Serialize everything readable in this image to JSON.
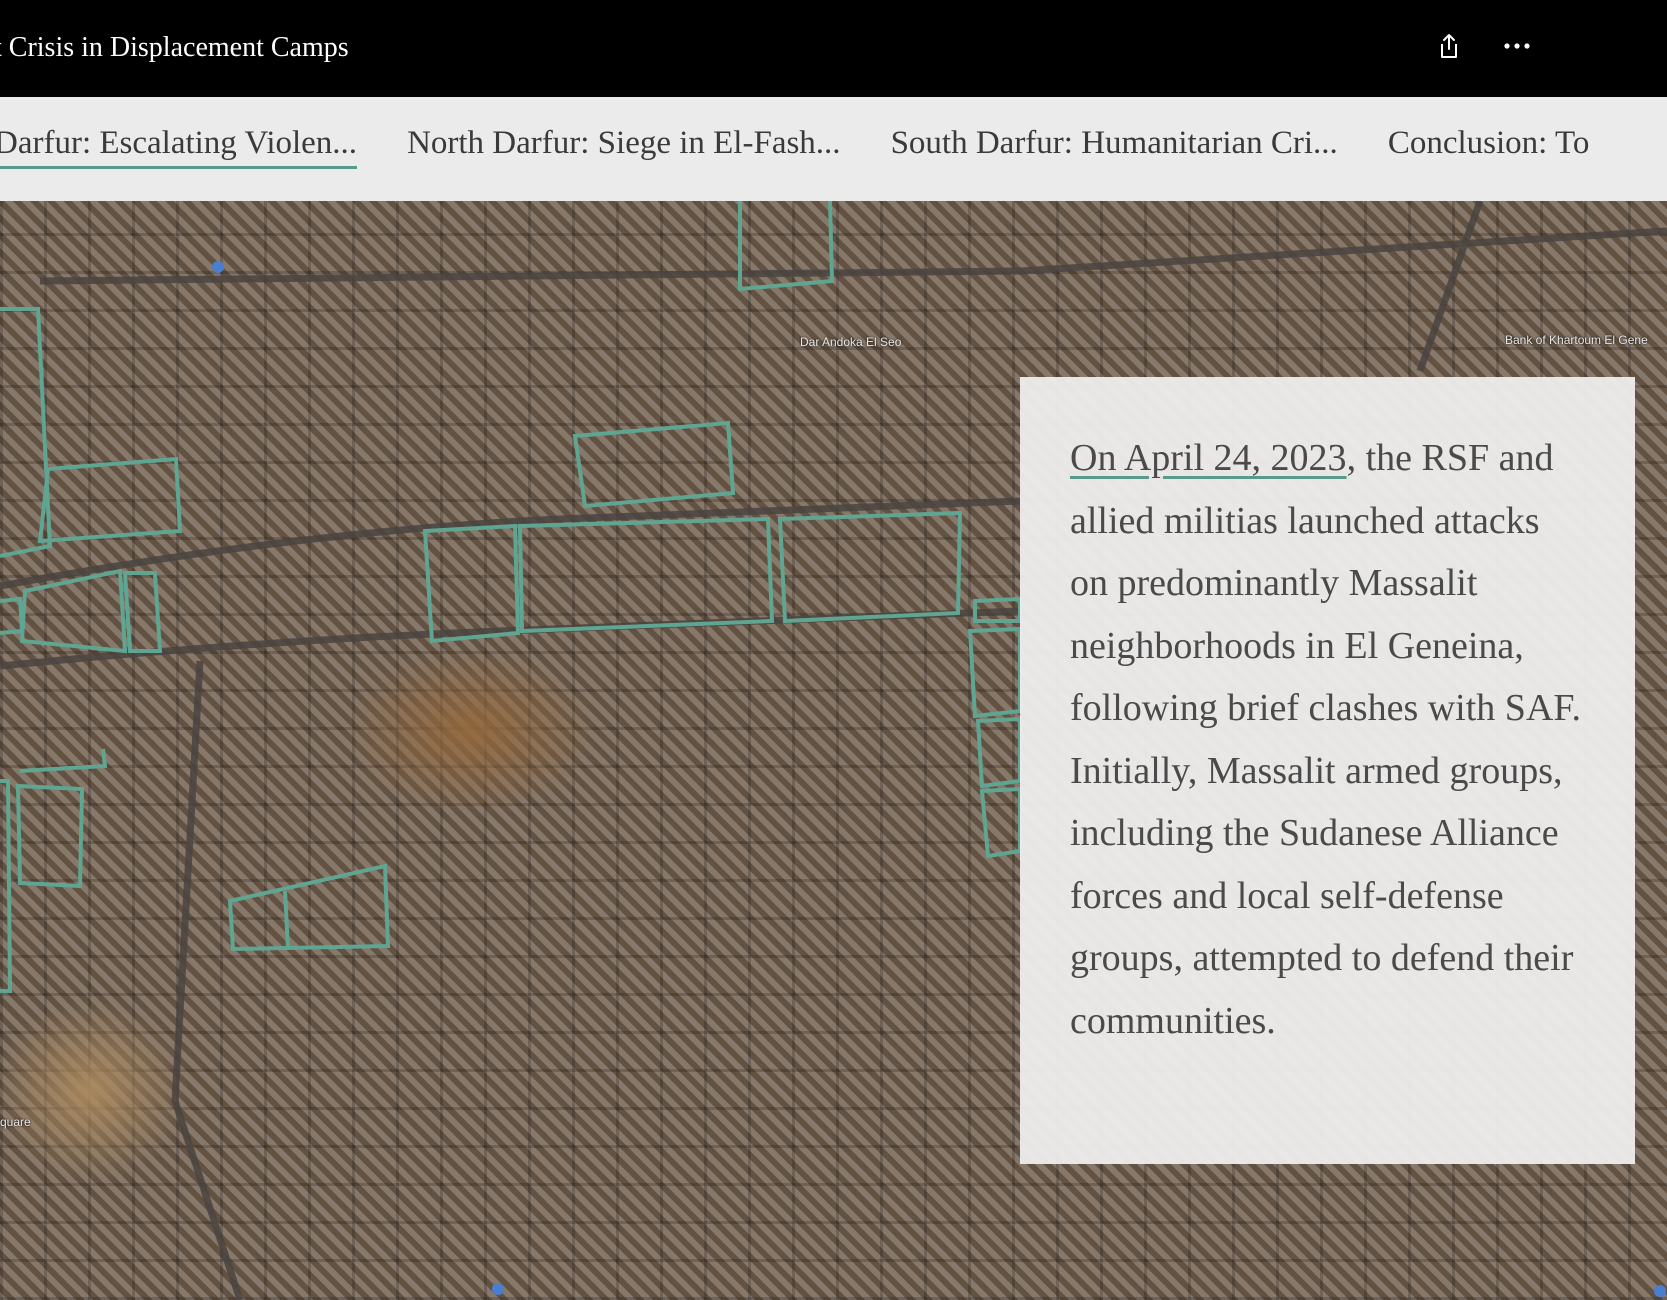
{
  "header": {
    "title": "t Crisis in Displacement Camps"
  },
  "nav": {
    "items": [
      {
        "label": "Darfur: Escalating Violen..."
      },
      {
        "label": "North Darfur: Siege in El-Fash..."
      },
      {
        "label": "South Darfur: Humanitarian Cri..."
      },
      {
        "label": "Conclusion: To"
      }
    ],
    "active_index": 0
  },
  "map": {
    "labels": {
      "dar_andoka": "Dar Andoka El Seo",
      "bank": "Bank of Khartoum El Gene",
      "square": "quare"
    },
    "outline_color": "#5fa592"
  },
  "story": {
    "date_link": "On April 24, 2023",
    "paragraph_rest": ", the RSF and allied militias launched attacks on predominantly Massalit neighborhoods in El Geneina, following brief clashes with SAF. Initially, Massalit armed groups, including the Sudanese Alliance forces and local self-defense groups, attempted to defend their communities."
  },
  "colors": {
    "accent": "#5a9a8a",
    "header_bg": "#000000",
    "nav_bg": "#ebebeb"
  }
}
